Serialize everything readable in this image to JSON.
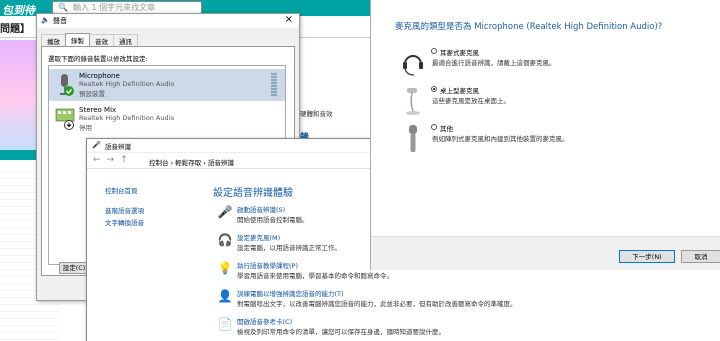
{
  "browser": {
    "logo": "包到待",
    "search_placeholder": "輸入 1 個字元來找文章",
    "question_title": "問題】",
    "bg_text_1": "硬體和音效",
    "bg_text_2": "錄"
  },
  "sound": {
    "title": "聲音",
    "close": "×",
    "tabs": [
      "播放",
      "錄製",
      "音效",
      "通訊"
    ],
    "hint": "選取下面的錄音裝置以修改其設定:",
    "devices": [
      {
        "name": "Microphone",
        "driver": "Realtek High Definition Audio",
        "status": "預設裝置",
        "selected": true
      },
      {
        "name": "Stereo Mix",
        "driver": "Realtek High Definition Audio",
        "status": "停用",
        "selected": false
      }
    ],
    "configure_label": "設定(C)"
  },
  "speech": {
    "title": "語音辨識",
    "nav": "←→↑",
    "crumbs": "控制台 › 輕鬆存取 › 語音辨識",
    "left_links": [
      "控制台首頁",
      "進階語音選項",
      "文字轉換語音"
    ],
    "heading": "設定語音辨識體驗",
    "items": [
      {
        "icon": "microphone-icon",
        "glyph": "🎤",
        "link": "啟動語音辨識(S)",
        "desc": "開始使用語音控制電腦。"
      },
      {
        "icon": "headset-icon",
        "glyph": "🎧",
        "link": "設定麥克風(M)",
        "desc": "設定電腦，以用語音辨識正常工作。"
      },
      {
        "icon": "lightbulb-icon",
        "glyph": "💡",
        "link": "執行語音教學課程(P)",
        "desc": "學習用語音來使用電腦，學習基本的命令和聽寫命令。"
      },
      {
        "icon": "user-train-icon",
        "glyph": "👤",
        "link": "訓練電腦以增強辨識您語音的能力(T)",
        "desc": "對電腦唸出文字，以改善電腦辨識您語音的能力，此並非必要，但有助於改善聽寫命令的準確度。"
      },
      {
        "icon": "reference-card-icon",
        "glyph": "📄",
        "link": "開啟語音參考卡(C)",
        "desc": "檢視及列印常用命令的清單，讓您可以保存在身邊，隨時知道要說什麼。"
      }
    ]
  },
  "wizard": {
    "question": "麥克風的類型是否為 Microphone (Realtek High Definition Audio)?",
    "options": [
      {
        "icon": "headset-mic-icon",
        "label": "耳麥式麥克風",
        "desc": "最適合進行語音辨識，請戴上這個麥克風。",
        "selected": false
      },
      {
        "icon": "desktop-mic-icon",
        "label": "桌上型麥克風",
        "desc": "這些麥克風是放在桌面上。",
        "selected": true
      },
      {
        "icon": "handheld-mic-icon",
        "label": "其他",
        "desc": "例如陣列式麥克風和內建到其他裝置的麥克風。",
        "selected": false
      }
    ],
    "next_label": "下一步(N)",
    "cancel_label": "取消"
  },
  "colors": {
    "accent": "#00a3a3",
    "link": "#0a50a0",
    "heading": "#1a5fa8"
  }
}
